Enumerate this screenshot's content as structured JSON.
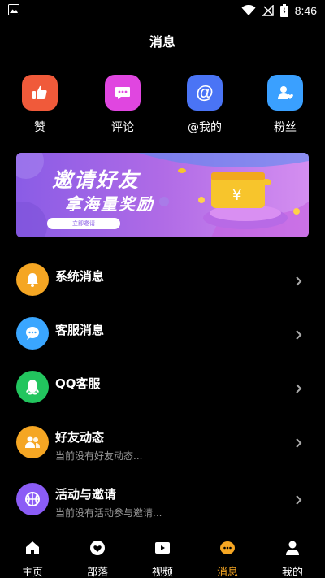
{
  "status_bar": {
    "time": "8:46"
  },
  "header": {
    "title": "消息"
  },
  "quick_actions": [
    {
      "label": "赞",
      "icon": "thumbs-up-icon",
      "color": "#f05a3a"
    },
    {
      "label": "评论",
      "icon": "comment-icon",
      "color": "#e046e0"
    },
    {
      "label": "@我的",
      "icon": "at-icon",
      "color": "#4a74f5"
    },
    {
      "label": "粉丝",
      "icon": "user-heart-icon",
      "color": "#3aa0ff"
    }
  ],
  "banner": {
    "title_line1": "邀请好友",
    "title_line2": "拿海量奖励",
    "button": "立即邀请"
  },
  "list": [
    {
      "title": "系统消息",
      "subtitle": "",
      "icon": "bell-icon",
      "color": "#f5a623"
    },
    {
      "title": "客服消息",
      "subtitle": "",
      "icon": "chat-bubble-icon",
      "color": "#3aa6ff"
    },
    {
      "title": "QQ客服",
      "subtitle": "",
      "icon": "qq-penguin-icon",
      "color": "#22c55e"
    },
    {
      "title": "好友动态",
      "subtitle": "当前没有好友动态...",
      "icon": "friends-icon",
      "color": "#f5a623"
    },
    {
      "title": "活动与邀请",
      "subtitle": "当前没有活动参与邀请...",
      "icon": "basketball-icon",
      "color": "#8b5cf6"
    }
  ],
  "bottom_nav": [
    {
      "label": "主页",
      "icon": "home-icon",
      "active": false
    },
    {
      "label": "部落",
      "icon": "tribe-icon",
      "active": false
    },
    {
      "label": "视频",
      "icon": "video-icon",
      "active": false
    },
    {
      "label": "消息",
      "icon": "message-icon",
      "active": true
    },
    {
      "label": "我的",
      "icon": "profile-icon",
      "active": false
    }
  ],
  "colors": {
    "accent": "#f5a623",
    "background": "#000000"
  }
}
